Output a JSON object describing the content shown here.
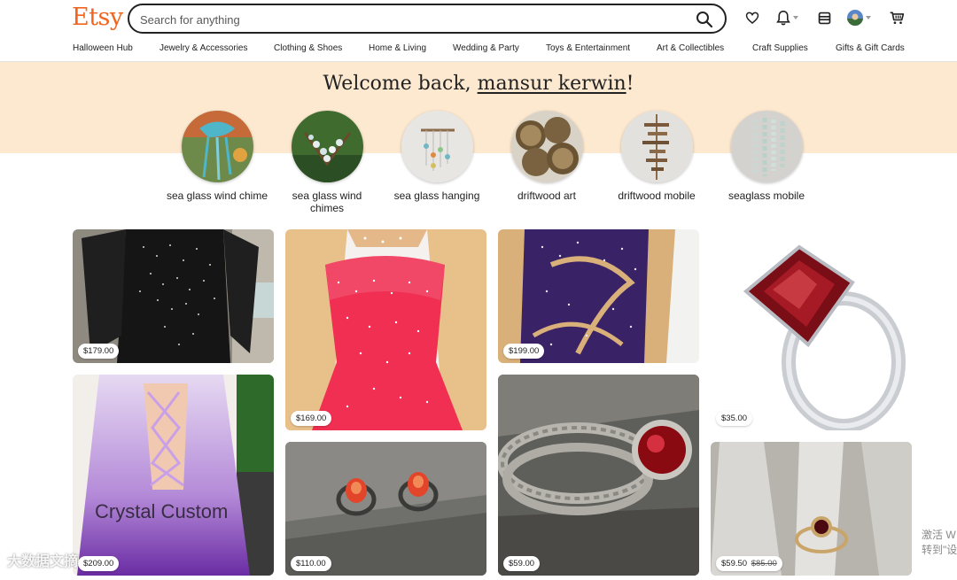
{
  "header": {
    "logo": "Etsy",
    "search_placeholder": "Search for anything",
    "icons": [
      "search-icon",
      "heart-icon",
      "bell-icon",
      "shop-icon",
      "avatar",
      "cart-icon"
    ]
  },
  "nav": [
    "Halloween Hub",
    "Jewelry & Accessories",
    "Clothing & Shoes",
    "Home & Living",
    "Wedding & Party",
    "Toys & Entertainment",
    "Art & Collectibles",
    "Craft Supplies",
    "Gifts & Gift Cards"
  ],
  "welcome": {
    "prefix": "Welcome back, ",
    "username": "mansur kerwin",
    "suffix": "!"
  },
  "recent": [
    {
      "label": "sea glass wind chime"
    },
    {
      "label": "sea glass wind chimes"
    },
    {
      "label": "sea glass hanging"
    },
    {
      "label": "driftwood art"
    },
    {
      "label": "driftwood mobile"
    },
    {
      "label": "seaglass mobile"
    }
  ],
  "listings": [
    {
      "price": "$179.00"
    },
    {
      "price": "$169.00"
    },
    {
      "price": "$199.00"
    },
    {
      "price": "$35.00"
    },
    {
      "price": "$209.00",
      "overlay": "Crystal Custom"
    },
    {
      "price": "$110.00"
    },
    {
      "price": "$59.00"
    },
    {
      "price": "$59.50",
      "original_price": "$85.00"
    }
  ],
  "watermarks": {
    "left": "大数据文摘",
    "right_line1": "激活 W",
    "right_line2": "转到\"设"
  },
  "colors": {
    "brand": "#f1641e",
    "band": "#fde9d0"
  }
}
